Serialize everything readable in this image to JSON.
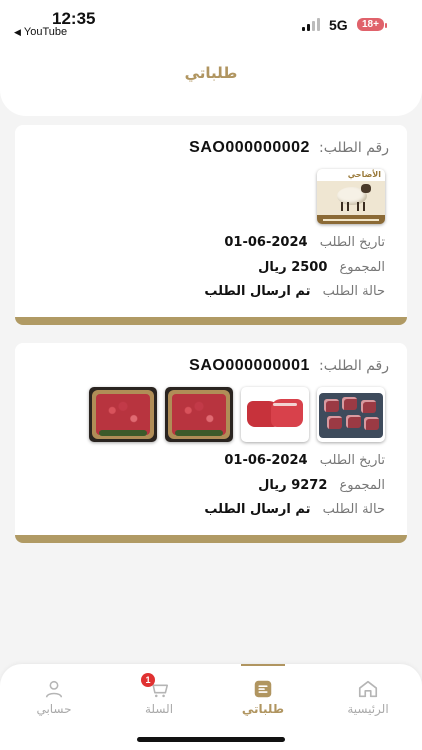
{
  "status_bar": {
    "time": "12:35",
    "back_label": "YouTube",
    "network": "5G",
    "battery_badge": "18+"
  },
  "header": {
    "title": "طلباتي"
  },
  "orders": [
    {
      "order_number_label": "رقم الطلب:",
      "order_number": "SAO000000002",
      "thumbnails": [
        {
          "icon": "sheep-product-image",
          "text": "الأضاحي"
        }
      ],
      "date_label": "تاريخ الطلب",
      "date": "2024-06-01",
      "total_label": "المجموع",
      "total": "2500 ريال",
      "status_label": "حالة الطلب",
      "status": "تم ارسال الطلب"
    },
    {
      "order_number_label": "رقم الطلب:",
      "order_number": "SAO000000001",
      "thumbnails": [
        {
          "icon": "meat-cubes-image"
        },
        {
          "icon": "steak-image"
        },
        {
          "icon": "minced-meat-image"
        },
        {
          "icon": "minced-meat-image"
        }
      ],
      "date_label": "تاريخ الطلب",
      "date": "2024-06-01",
      "total_label": "المجموع",
      "total": "9272 ريال",
      "status_label": "حالة الطلب",
      "status": "تم ارسال الطلب"
    }
  ],
  "tabbar": {
    "items": [
      {
        "label": "الرئيسية",
        "icon": "home-icon",
        "active": false
      },
      {
        "label": "طلباتي",
        "icon": "orders-icon",
        "active": true
      },
      {
        "label": "السلة",
        "icon": "cart-icon",
        "active": false,
        "badge": "1"
      },
      {
        "label": "حسابي",
        "icon": "user-icon",
        "active": false
      }
    ]
  },
  "colors": {
    "accent": "#b09560",
    "card_bar": "#b09a64",
    "badge": "#e03131"
  }
}
